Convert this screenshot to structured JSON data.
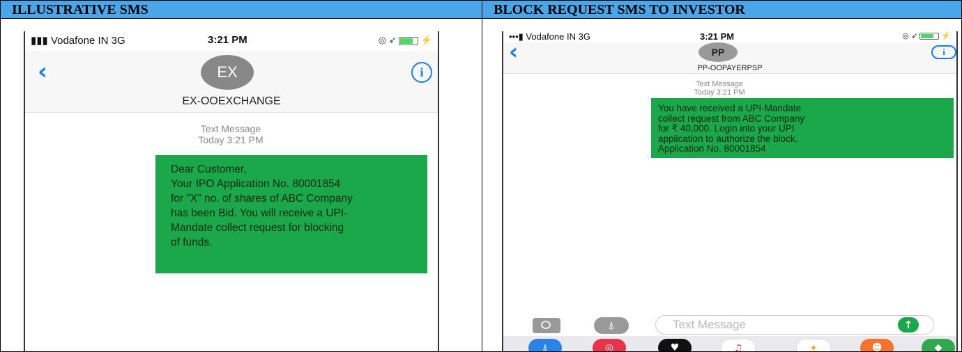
{
  "left_panel": {
    "header": "ILLUSTRATIVE SMS",
    "status": {
      "carrier": "Vodafone IN  3G",
      "time": "3:21 PM"
    },
    "avatar": "EX",
    "contact": "EX-OOEXCHANGE",
    "meta_label": "Text Message",
    "meta_time": "Today 3:21 PM",
    "message": "Dear Customer,\nYour IPO Application No. 80001854\nfor \"X\" no. of shares of ABC Company\nhas been Bid. You will receive a UPI-\nMandate collect request for blocking\nof funds."
  },
  "right_panel": {
    "header": "BLOCK REQUEST SMS TO INVESTOR",
    "status": {
      "carrier": "Vodafone IN  3G",
      "time": "3:21 PM"
    },
    "avatar": "PP",
    "contact": "PP-OOPAYERPSP",
    "meta_label": "Text Message",
    "meta_time": "Today 3:21 PM",
    "message": "You have received a UPI-Mandate\ncollect request from ABC Company\nfor ₹ 40,000. Login into your UPI\napplication to authorize the block.\nApplication No. 80001854",
    "composer_placeholder": "Text Message"
  },
  "colors": {
    "header_bg": "#4aa6e8",
    "bubble": "#1aa84b",
    "ios_blue": "#1a7cf0"
  },
  "icons": [
    "signal-icon",
    "back-chevron-icon",
    "info-icon",
    "camera-icon",
    "appstore-icon",
    "send-arrow-icon",
    "battery-icon"
  ]
}
